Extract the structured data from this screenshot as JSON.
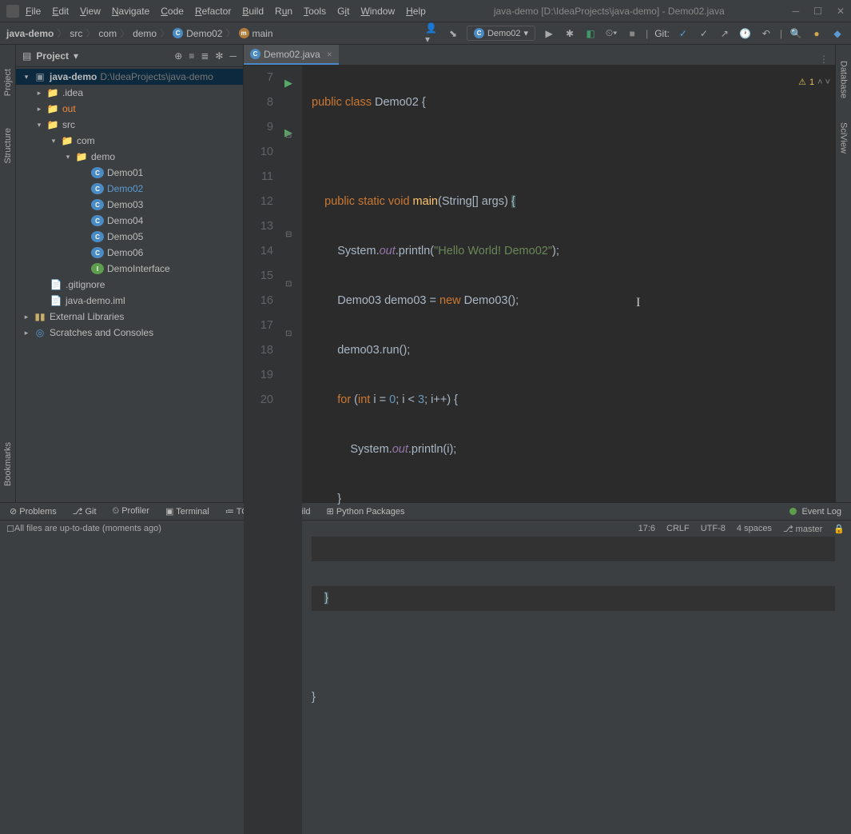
{
  "title": "java-demo [D:\\IdeaProjects\\java-demo] - Demo02.java",
  "menu": [
    "File",
    "Edit",
    "View",
    "Navigate",
    "Code",
    "Refactor",
    "Build",
    "Run",
    "Tools",
    "Git",
    "Window",
    "Help"
  ],
  "breadcrumb": [
    "java-demo",
    "src",
    "com",
    "demo",
    "Demo02",
    "main"
  ],
  "runConfig": "Demo02",
  "gitLabel": "Git:",
  "projectPanel": {
    "title": "Project"
  },
  "tree": {
    "root": "java-demo",
    "rootPath": "D:\\IdeaProjects\\java-demo",
    "idea": ".idea",
    "out": "out",
    "src": "src",
    "com": "com",
    "demo": "demo",
    "classes": [
      "Demo01",
      "Demo02",
      "Demo03",
      "Demo04",
      "Demo05",
      "Demo06"
    ],
    "iface": "DemoInterface",
    "gitignore": ".gitignore",
    "iml": "java-demo.iml",
    "ext": "External Libraries",
    "scratch": "Scratches and Consoles"
  },
  "tab": "Demo02.java",
  "lineStart": 7,
  "lineEnd": 20,
  "code": {
    "l7": {
      "a": "public class",
      "b": "Demo02",
      "c": "{"
    },
    "l9": {
      "a": "public static void",
      "b": "main",
      "c": "(String[] args) ",
      "d": "{"
    },
    "l10": {
      "a": "System.",
      "b": "out",
      "c": ".println(",
      "d": "\"Hello World! Demo02\"",
      "e": ");"
    },
    "l11": {
      "a": "Demo03 demo03 = ",
      "b": "new",
      "c": " Demo03();"
    },
    "l12": "demo03.run();",
    "l13": {
      "a": "for",
      "b": " (",
      "c": "int",
      "d": " i = ",
      "e": "0",
      "f": "; i < ",
      "g": "3",
      "h": "; i++) {"
    },
    "l14": {
      "a": "System.",
      "b": "out",
      "c": ".println(i);"
    },
    "l15": "}",
    "l17": "}",
    "l19": "}"
  },
  "inspection": "1",
  "bottomTabs": [
    "Problems",
    "Git",
    "Profiler",
    "Terminal",
    "TODO",
    "Build",
    "Python Packages"
  ],
  "eventLog": "Event Log",
  "statusMsg": "All files are up-to-date (moments ago)",
  "status": {
    "pos": "17:6",
    "eol": "CRLF",
    "enc": "UTF-8",
    "indent": "4 spaces",
    "branch": "master"
  },
  "rightTabs": [
    "Database",
    "SciView"
  ],
  "leftTabs": [
    "Project",
    "Structure",
    "Bookmarks"
  ]
}
